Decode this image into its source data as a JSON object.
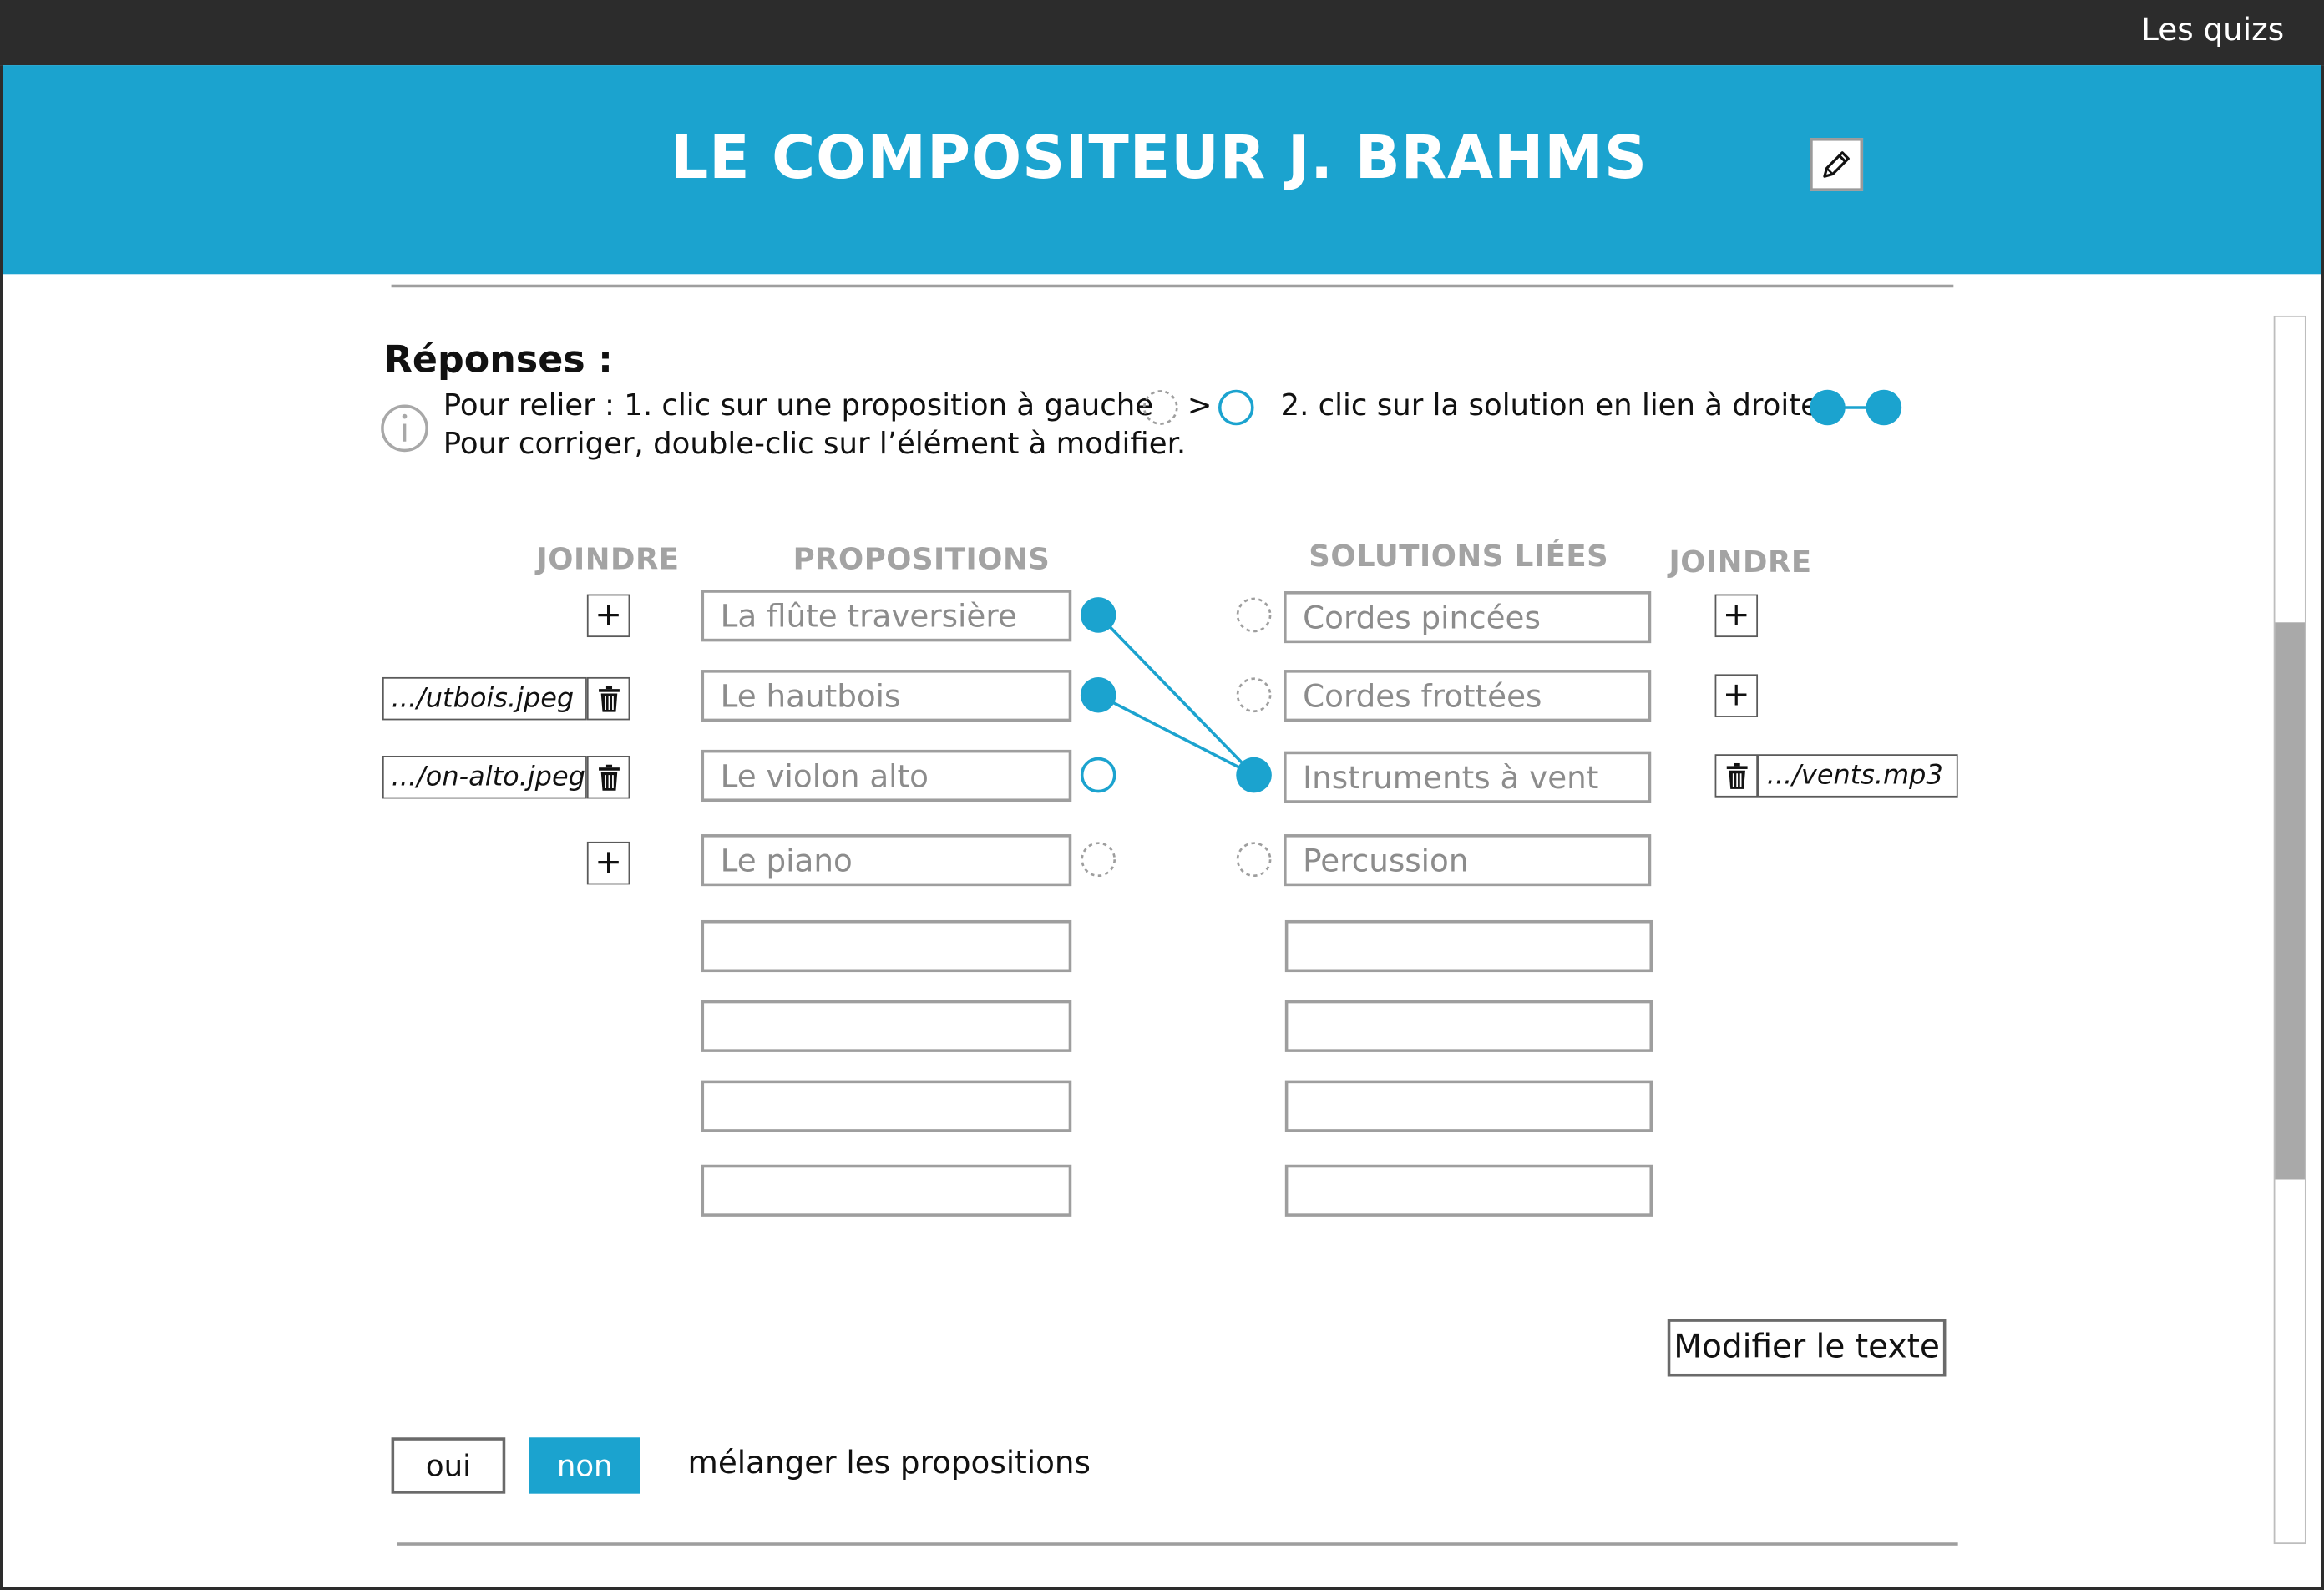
{
  "topbar": {
    "link": "Les quizs"
  },
  "header": {
    "title": "LE COMPOSITEUR J. BRAHMS",
    "edit_icon": "pencil-icon"
  },
  "accent_color": "#1ba3cf",
  "responses": {
    "title": "Réponses :",
    "instruction_1a": "Pour relier : 1. clic sur une proposition à gauche",
    "instruction_1b": ">",
    "instruction_1c": "2. clic sur la solution en lien à droite",
    "instruction_2": "Pour corriger, double-clic sur l’élément à modifier."
  },
  "columns": {
    "join_left": "JOINDRE",
    "propositions": "PROPOSITIONS",
    "solutions": "SOLUTIONS LIÉES",
    "join_right": "JOINDRE"
  },
  "propositions": [
    {
      "label": "La flûte traversière",
      "attachment": "",
      "state": "linked",
      "links_to": 2
    },
    {
      "label": "Le hautbois",
      "attachment": ".../utbois.jpeg",
      "state": "linked",
      "links_to": 2
    },
    {
      "label": "Le violon alto",
      "attachment": ".../on-alto.jpeg",
      "state": "selected",
      "links_to": null
    },
    {
      "label": "Le piano",
      "attachment": "",
      "state": "empty",
      "links_to": null
    },
    {
      "label": ""
    },
    {
      "label": ""
    },
    {
      "label": ""
    },
    {
      "label": ""
    }
  ],
  "solutions": [
    {
      "label": "Cordes pincées",
      "attachment": "",
      "state": "empty"
    },
    {
      "label": "Cordes frottées",
      "attachment": "",
      "state": "empty"
    },
    {
      "label": "Instruments à vent",
      "attachment": ".../vents.mp3",
      "state": "linked"
    },
    {
      "label": "Percussion",
      "attachment": "",
      "state": "empty"
    },
    {
      "label": ""
    },
    {
      "label": ""
    },
    {
      "label": ""
    },
    {
      "label": ""
    }
  ],
  "buttons": {
    "add": "+",
    "modify_text": "Modifier le texte",
    "yes": "oui",
    "no": "non",
    "shuffle_label": "mélanger les propositions"
  }
}
